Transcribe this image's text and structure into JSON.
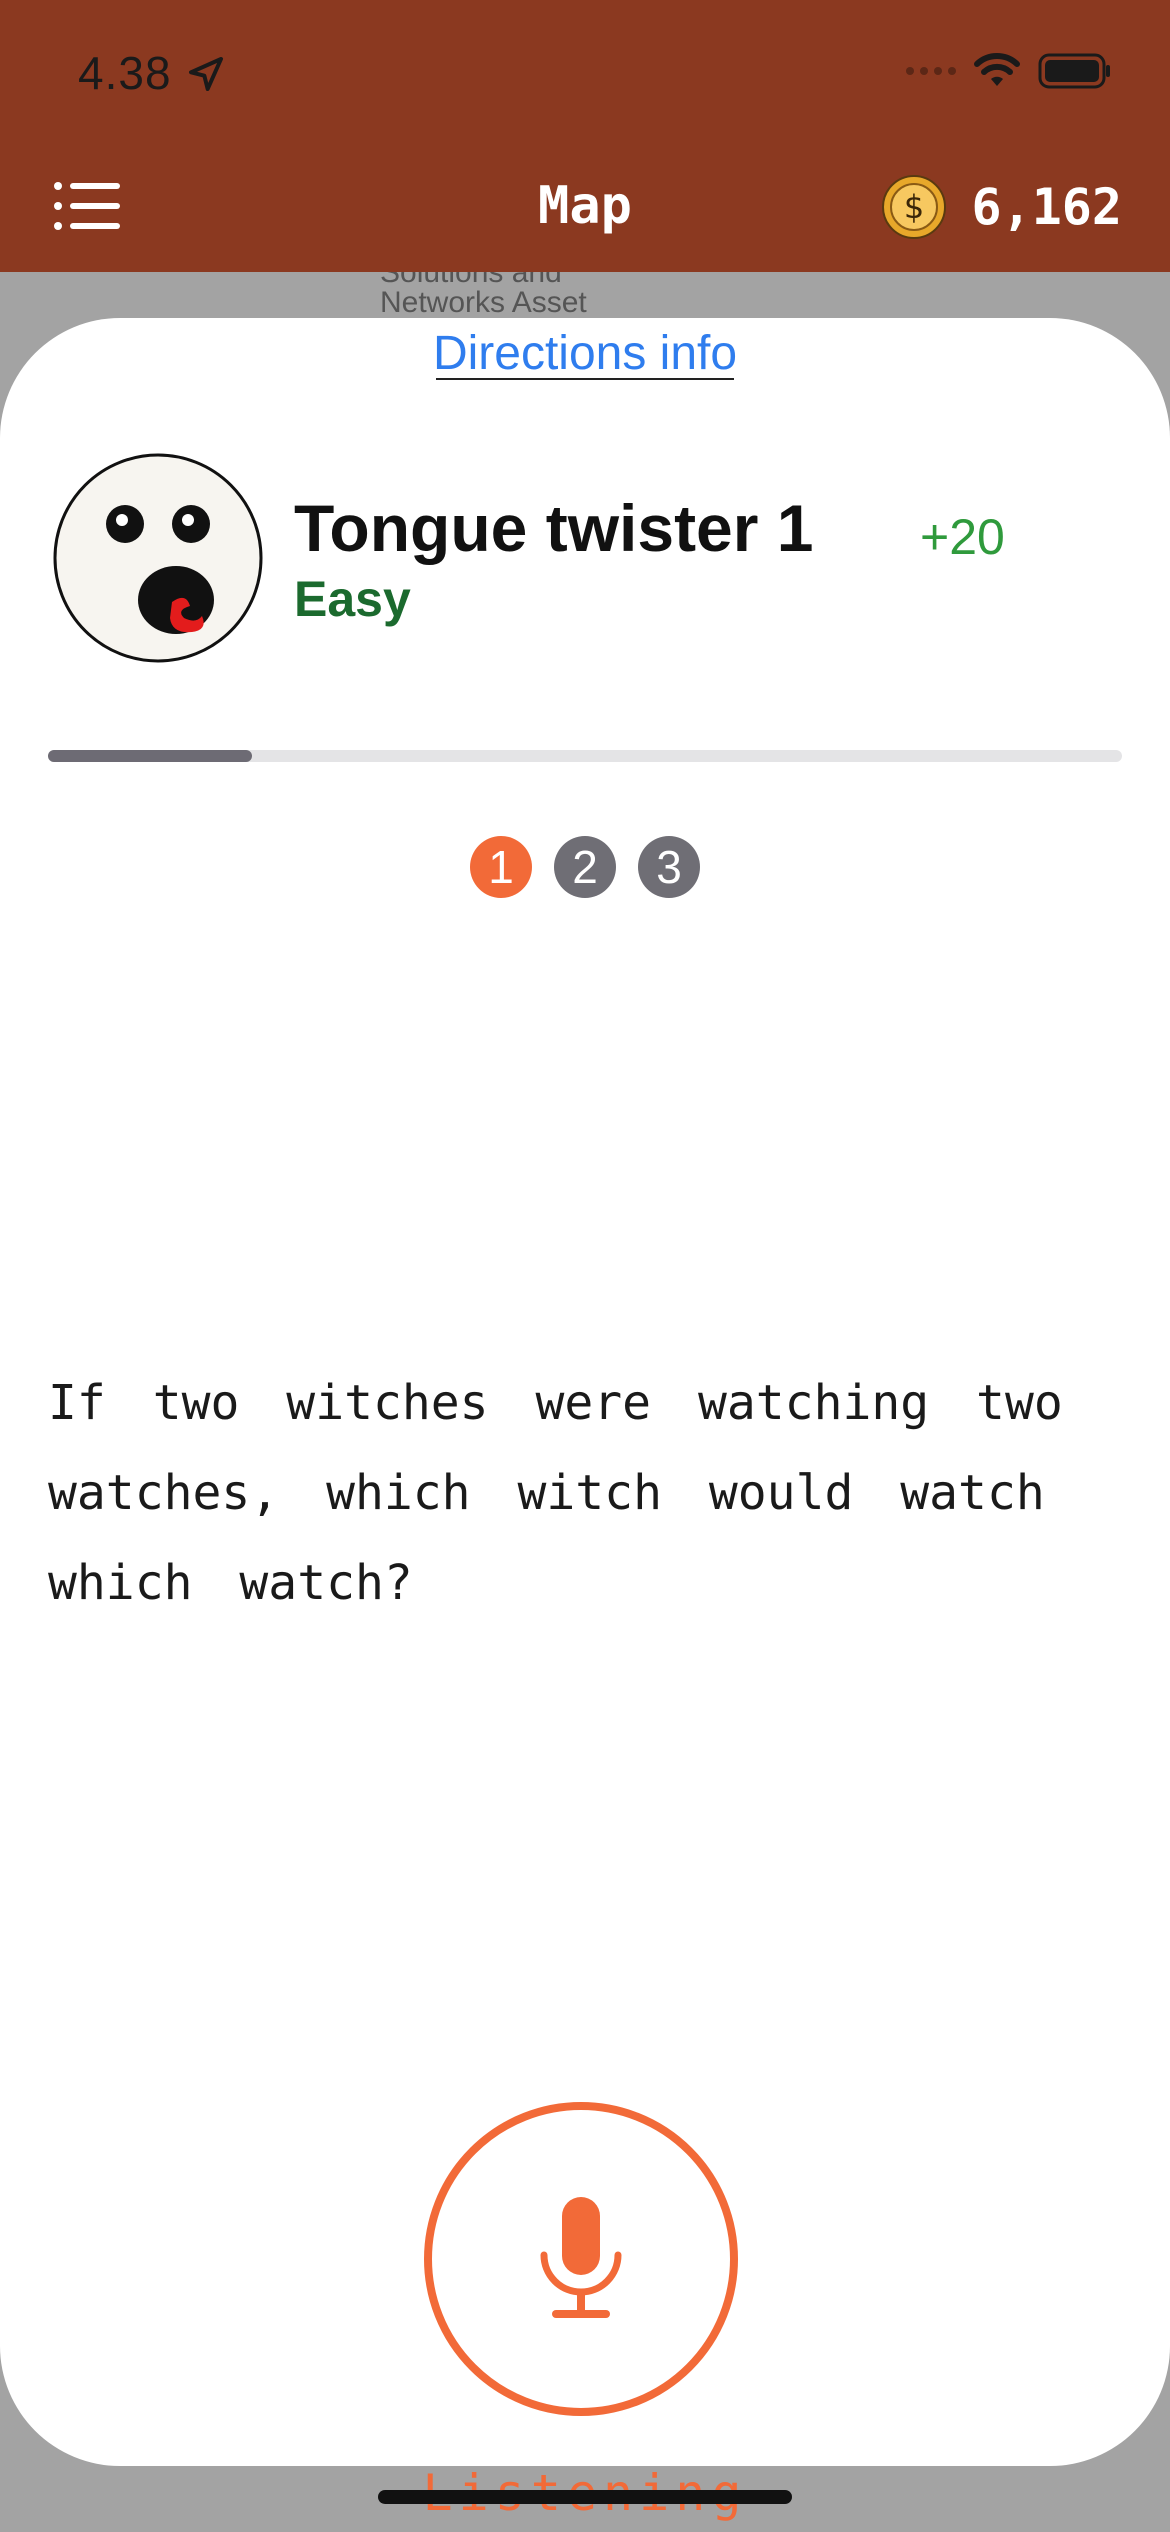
{
  "status_bar": {
    "time": "4.38",
    "icons": [
      "location-arrow-icon",
      "signal-icon",
      "wifi-icon",
      "battery-icon"
    ]
  },
  "header": {
    "title": "Map",
    "menu_icon": "list-icon",
    "coin_icon": "dollar-coin-icon",
    "coins": "6,162"
  },
  "map": {
    "label": "Solutions and\nNetworks Asset"
  },
  "sheet": {
    "directions_link": "Directions info",
    "challenge": {
      "avatar_icon": "surprised-face-icon",
      "title": "Tongue twister 1",
      "difficulty": "Easy",
      "reward": "+20"
    },
    "progress": {
      "fraction": 0.19
    },
    "steps": [
      {
        "label": "1",
        "active": true
      },
      {
        "label": "2",
        "active": false
      },
      {
        "label": "3",
        "active": false
      }
    ],
    "twister_text": "If two witches were watching two watches, which witch would watch which watch?",
    "mic_icon": "microphone-icon",
    "listening_label": "Listening"
  },
  "colors": {
    "header_bg": "#8b3920",
    "accent": "#f26a38",
    "link": "#2f7dee",
    "difficulty": "#1b6a2e",
    "reward": "#2f9a3c"
  }
}
